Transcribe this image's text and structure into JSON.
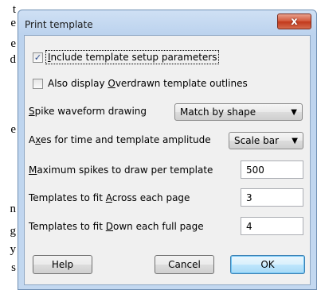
{
  "background_text": [
    "t",
    "e",
    "e",
    "d",
    "e",
    "n",
    "g",
    "y",
    "s"
  ],
  "dialog": {
    "title": "Print template",
    "close_glyph": "x",
    "include_setup": {
      "label": "Include template setup parameters",
      "mnemonic_pre": "",
      "mnemonic": "I",
      "mnemonic_post": "nclude template setup parameters",
      "checked": true,
      "check_glyph": "✓"
    },
    "display_overdrawn": {
      "mnemonic_pre": "Also display ",
      "mnemonic": "O",
      "mnemonic_post": "verdrawn template outlines",
      "checked": false
    },
    "spike_waveform": {
      "mnemonic_pre": "",
      "mnemonic": "S",
      "mnemonic_post": "pike waveform drawing",
      "value": "Match by shape"
    },
    "axes": {
      "mnemonic_pre": "A",
      "mnemonic": "x",
      "mnemonic_post": "es for time and template amplitude",
      "value": "Scale bar"
    },
    "max_spikes": {
      "mnemonic_pre": "",
      "mnemonic": "M",
      "mnemonic_post": "aximum spikes to draw per template",
      "value": "500"
    },
    "across": {
      "mnemonic_pre": "Templates to fit ",
      "mnemonic": "A",
      "mnemonic_post": "cross each page",
      "value": "3"
    },
    "down": {
      "mnemonic_pre": "Templates to fit ",
      "mnemonic": "D",
      "mnemonic_post": "own each full page",
      "value": "4"
    },
    "dropdown_glyph": "▼",
    "buttons": {
      "help": "Help",
      "cancel": "Cancel",
      "ok": "OK"
    }
  }
}
